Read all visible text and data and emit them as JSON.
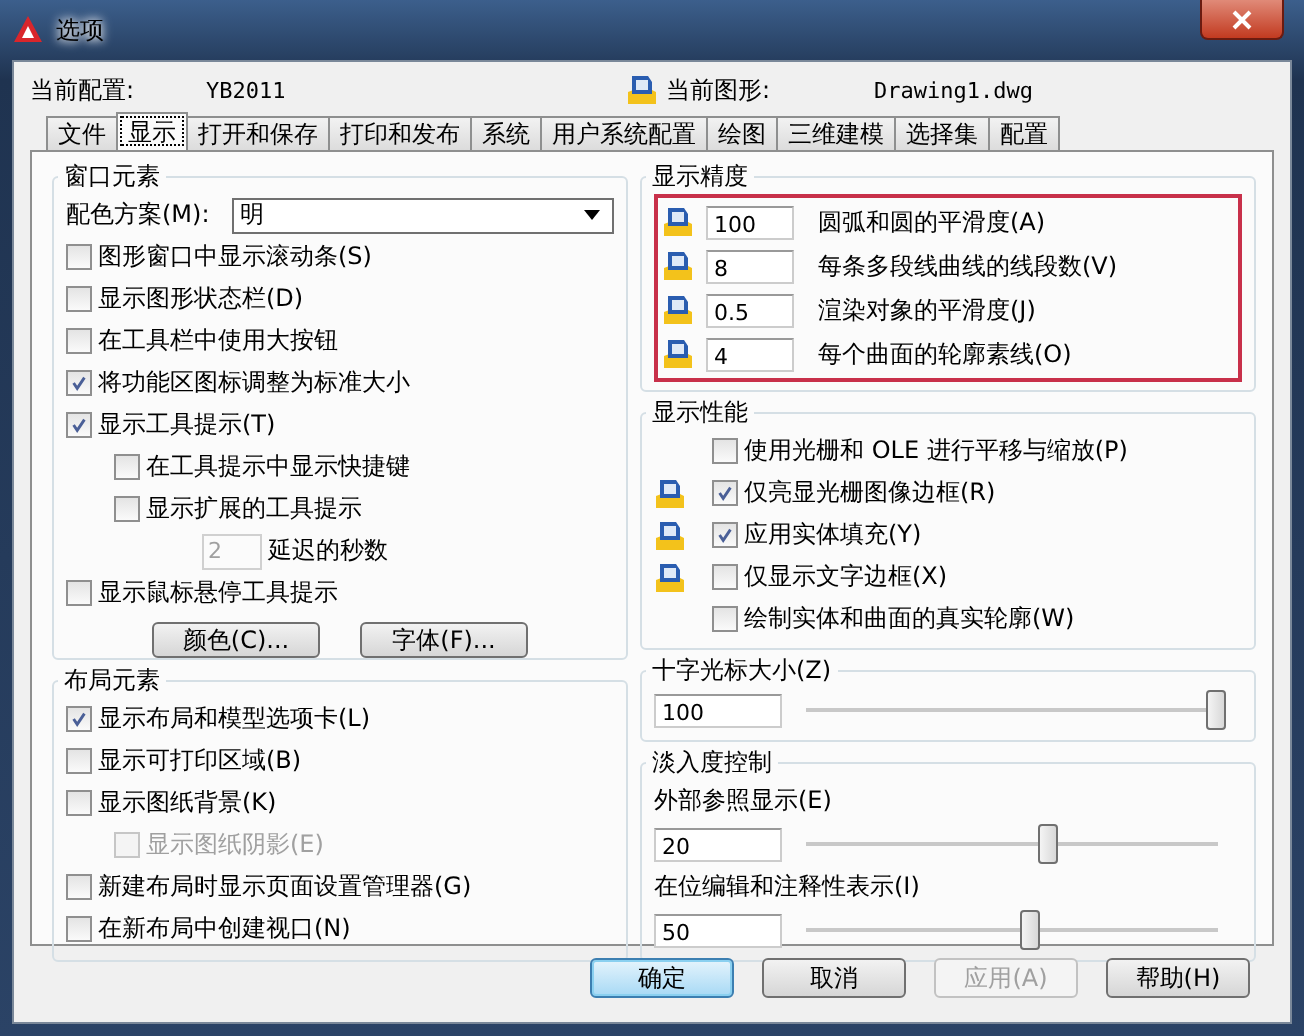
{
  "window": {
    "title": "选项"
  },
  "header": {
    "profile_label": "当前配置:",
    "profile": "YB2011",
    "drawing_label": "当前图形:",
    "drawing": "Drawing1.dwg"
  },
  "tabs": [
    {
      "label": "文件",
      "selected": false
    },
    {
      "label": "显示",
      "selected": true
    },
    {
      "label": "打开和保存",
      "selected": false
    },
    {
      "label": "打印和发布",
      "selected": false
    },
    {
      "label": "系统",
      "selected": false
    },
    {
      "label": "用户系统配置",
      "selected": false
    },
    {
      "label": "绘图",
      "selected": false
    },
    {
      "label": "三维建模",
      "selected": false
    },
    {
      "label": "选择集",
      "selected": false
    },
    {
      "label": "配置",
      "selected": false
    }
  ],
  "window_elements": {
    "title": "窗口元素",
    "scheme_label": "配色方案(M):",
    "scheme_value": "明",
    "items": [
      {
        "kind": "checkbox",
        "label": "图形窗口中显示滚动条(S)",
        "checked": false,
        "disabled": false
      },
      {
        "kind": "checkbox",
        "label": "显示图形状态栏(D)",
        "checked": false,
        "disabled": false
      },
      {
        "kind": "checkbox",
        "label": "在工具栏中使用大按钮",
        "checked": false,
        "disabled": false
      },
      {
        "kind": "checkbox",
        "label": "将功能区图标调整为标准大小",
        "checked": true,
        "disabled": false
      },
      {
        "kind": "checkbox",
        "label": "显示工具提示(T)",
        "checked": true,
        "disabled": false,
        "children": [
          {
            "kind": "checkbox",
            "label": "在工具提示中显示快捷键",
            "checked": false,
            "disabled": false
          },
          {
            "kind": "checkbox",
            "label": "显示扩展的工具提示",
            "checked": false,
            "disabled": false,
            "children": [
              {
                "kind": "number",
                "value": "2",
                "label": "延迟的秒数",
                "disabled": true
              }
            ]
          }
        ]
      },
      {
        "kind": "checkbox",
        "label": "显示鼠标悬停工具提示",
        "checked": false,
        "disabled": false
      }
    ],
    "buttons": [
      "颜色(C)...",
      "字体(F)..."
    ]
  },
  "layout_elements": {
    "title": "布局元素",
    "items": [
      {
        "label": "显示布局和模型选项卡(L)",
        "checked": true,
        "disabled": false
      },
      {
        "label": "显示可打印区域(B)",
        "checked": false,
        "disabled": false
      },
      {
        "label": "显示图纸背景(K)",
        "checked": false,
        "disabled": false,
        "children": [
          {
            "label": "显示图纸阴影(E)",
            "checked": false,
            "disabled": true
          }
        ]
      },
      {
        "label": "新建布局时显示页面设置管理器(G)",
        "checked": false,
        "disabled": false
      },
      {
        "label": "在新布局中创建视口(N)",
        "checked": false,
        "disabled": false
      }
    ]
  },
  "display_resolution": {
    "title": "显示精度",
    "highlighted": true,
    "rows": [
      {
        "value": "100",
        "label": "圆弧和圆的平滑度(A)"
      },
      {
        "value": "8",
        "label": "每条多段线曲线的线段数(V)"
      },
      {
        "value": "0.5",
        "label": "渲染对象的平滑度(J)"
      },
      {
        "value": "4",
        "label": "每个曲面的轮廓素线(O)"
      }
    ]
  },
  "display_performance": {
    "title": "显示性能",
    "items": [
      {
        "label": "使用光栅和 OLE 进行平移与缩放(P)",
        "checked": false,
        "icon": false
      },
      {
        "label": "仅亮显光栅图像边框(R)",
        "checked": true,
        "icon": true
      },
      {
        "label": "应用实体填充(Y)",
        "checked": true,
        "icon": true
      },
      {
        "label": "仅显示文字边框(X)",
        "checked": false,
        "icon": true
      },
      {
        "label": "绘制实体和曲面的真实轮廓(W)",
        "checked": false,
        "icon": false
      }
    ]
  },
  "crosshair": {
    "title": "十字光标大小(Z)",
    "value": "100",
    "level": 1.0
  },
  "fade": {
    "title": "淡入度控制",
    "sliders": [
      {
        "label": "外部参照显示(E)",
        "value": "20",
        "level": 0.59
      },
      {
        "label": "在位编辑和注释性表示(I)",
        "value": "50",
        "level": 0.55
      }
    ]
  },
  "buttons": [
    {
      "label": "确定",
      "default": true,
      "disabled": false
    },
    {
      "label": "取消",
      "default": false,
      "disabled": false
    },
    {
      "label": "应用(A)",
      "default": false,
      "disabled": true
    },
    {
      "label": "帮助(H)",
      "default": false,
      "disabled": false
    }
  ]
}
